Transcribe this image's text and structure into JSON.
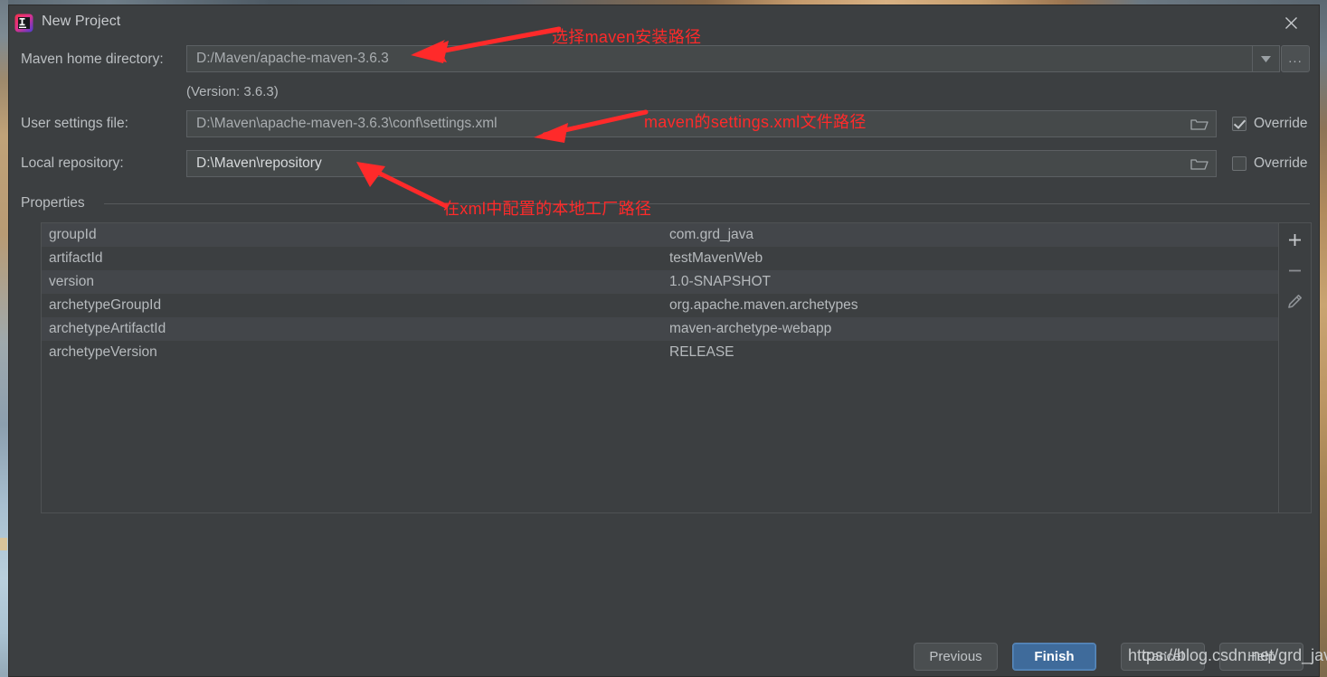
{
  "window": {
    "title": "New Project",
    "app_icon": "intellij-idea-icon",
    "close_icon": "close-icon"
  },
  "form": {
    "maven_home": {
      "label": "Maven home directory:",
      "value": "D:/Maven/apache-maven-3.6.3",
      "dropdown_icon": "chevron-down-icon",
      "browse_label": "...",
      "version_note": "(Version: 3.6.3)"
    },
    "user_settings": {
      "label": "User settings file:",
      "value": "D:\\Maven\\apache-maven-3.6.3\\conf\\settings.xml",
      "folder_icon": "folder-icon",
      "override_label": "Override",
      "override_checked": true
    },
    "local_repository": {
      "label": "Local repository:",
      "value": "D:\\Maven\\repository",
      "folder_icon": "folder-icon",
      "override_label": "Override",
      "override_checked": false
    }
  },
  "properties": {
    "group_label": "Properties",
    "rows": [
      {
        "key": "groupId",
        "value": "com.grd_java"
      },
      {
        "key": "artifactId",
        "value": "testMavenWeb"
      },
      {
        "key": "version",
        "value": "1.0-SNAPSHOT"
      },
      {
        "key": "archetypeGroupId",
        "value": "org.apache.maven.archetypes"
      },
      {
        "key": "archetypeArtifactId",
        "value": "maven-archetype-webapp"
      },
      {
        "key": "archetypeVersion",
        "value": "RELEASE"
      }
    ],
    "toolbar": [
      {
        "name": "add-property-button",
        "icon": "plus-icon"
      },
      {
        "name": "remove-property-button",
        "icon": "minus-icon"
      },
      {
        "name": "edit-property-button",
        "icon": "pencil-icon"
      }
    ]
  },
  "footer": {
    "previous_label": "Previous",
    "finish_label": "Finish",
    "cancel_label": "Cancel",
    "help_label": "Help"
  },
  "annotations": [
    {
      "text": "选择maven安装路径"
    },
    {
      "text": "maven的settings.xml文件路径"
    },
    {
      "text": "在xml中配置的本地工厂路径"
    }
  ],
  "watermark": {
    "text": "https://blog.csdn.net/grd_java"
  },
  "colors": {
    "dialog_bg": "#3c3f41",
    "field_bg": "#45494a",
    "accent_button": "#3f6b9b",
    "annotation_red": "#ff2a2a"
  }
}
